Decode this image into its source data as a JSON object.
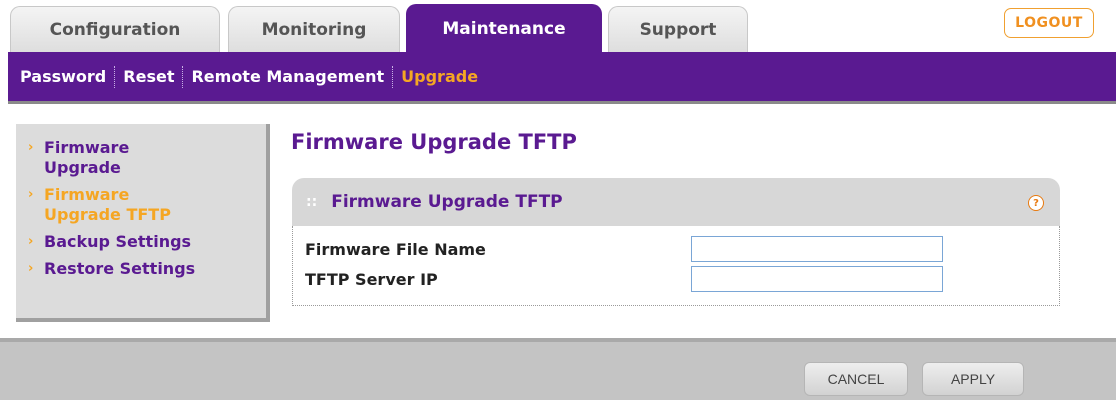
{
  "tabs": [
    {
      "label": "Configuration",
      "active": false
    },
    {
      "label": "Monitoring",
      "active": false
    },
    {
      "label": "Maintenance",
      "active": true
    },
    {
      "label": "Support",
      "active": false
    }
  ],
  "logout_label": "LOGOUT",
  "subnav": {
    "items": [
      "Password",
      "Reset",
      "Remote Management",
      "Upgrade"
    ],
    "active": "Upgrade"
  },
  "leftmenu": {
    "items": [
      {
        "label": "Firmware Upgrade",
        "active": false
      },
      {
        "label": "Firmware Upgrade TFTP",
        "active": true
      },
      {
        "label": "Backup Settings",
        "active": false
      },
      {
        "label": "Restore Settings",
        "active": false
      }
    ]
  },
  "content": {
    "page_title": "Firmware Upgrade TFTP",
    "panel_title": "Firmware Upgrade TFTP",
    "help_icon": "?",
    "fields": [
      {
        "label": "Firmware File Name",
        "value": ""
      },
      {
        "label": "TFTP Server IP",
        "value": ""
      }
    ]
  },
  "footer": {
    "cancel_label": "CANCEL",
    "apply_label": "APPLY"
  },
  "colors": {
    "brand_purple": "#5a1a91",
    "accent_orange": "#f5a623"
  }
}
